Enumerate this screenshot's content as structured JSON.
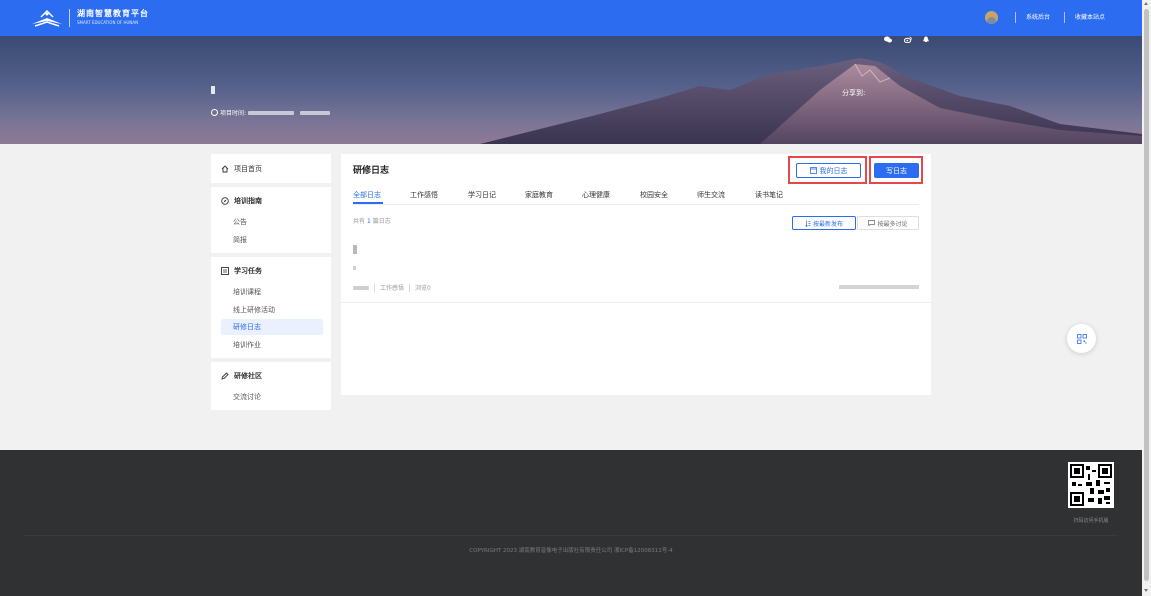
{
  "header": {
    "logo_cn": "湖南智慧教育平台",
    "logo_en": "SMART EDUCATION OF HUNAN",
    "links": [
      "系统后台",
      "收藏本站点"
    ]
  },
  "banner": {
    "project_time_label": "项目时间:",
    "share_label": "分享到:"
  },
  "sidebar": {
    "home": "项目首页",
    "guide": {
      "title": "培训指南",
      "items": [
        "公告",
        "简报"
      ]
    },
    "tasks": {
      "title": "学习任务",
      "items": [
        "培训课程",
        "线上研修活动",
        "研修日志",
        "培训作业"
      ],
      "active_index": 2
    },
    "community": {
      "title": "研修社区",
      "items": [
        "交流讨论"
      ]
    }
  },
  "main": {
    "title": "研修日志",
    "my_diary_button": "我的日志",
    "write_button": "写日志",
    "tabs": [
      "全部日志",
      "工作感悟",
      "学习日记",
      "家庭教育",
      "心理健康",
      "校园安全",
      "师生交流",
      "读书笔记"
    ],
    "active_tab": 0,
    "count_prefix": "共有",
    "count_value": "1",
    "count_suffix": "篇日志",
    "sort_newest": "按最新发布",
    "sort_most_discussed": "按最多讨论",
    "entry": {
      "category": "工作感悟",
      "views": "浏览0"
    }
  },
  "footer": {
    "copyright": "COPYRIGHT 2023 湖南教育音像电子出版社有限责任公司 湘ICP备12008311号-4",
    "qr_caption": "扫码访问手机版"
  },
  "colors": {
    "primary": "#2b6cf0",
    "highlight_border": "#e54848",
    "footer_bg": "#303133"
  }
}
